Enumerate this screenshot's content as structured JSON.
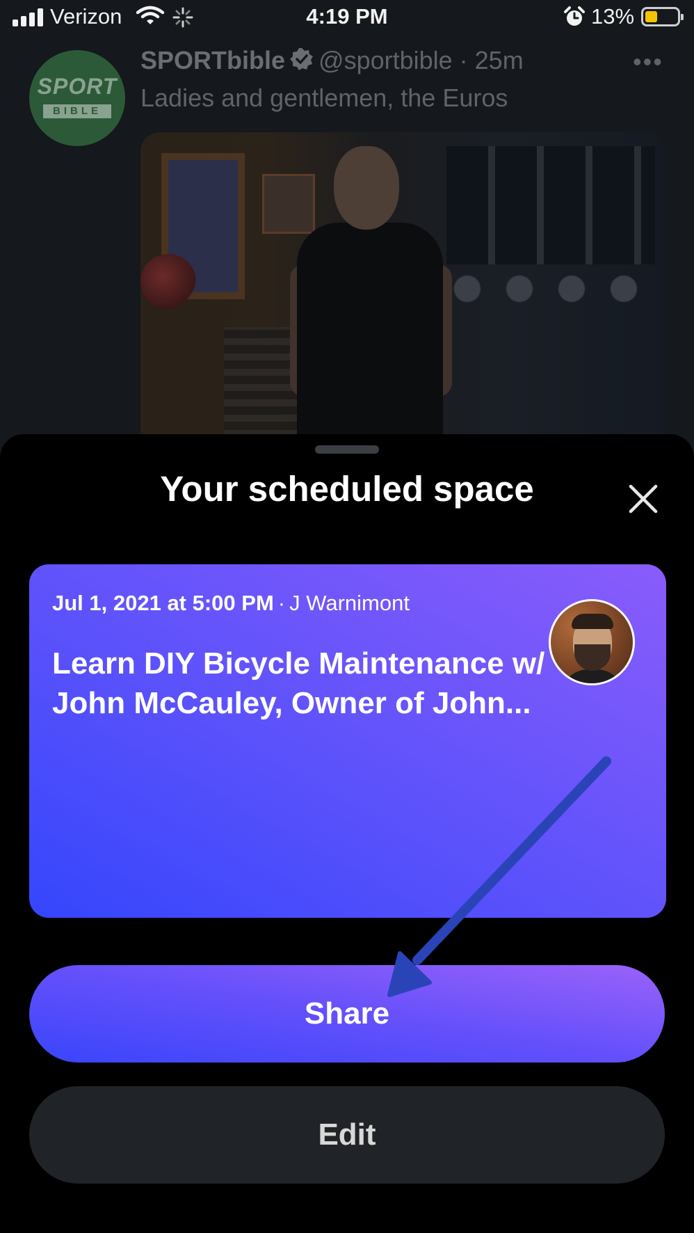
{
  "status_bar": {
    "carrier": "Verizon",
    "time": "4:19 PM",
    "battery_percent": "13%",
    "battery_level": 0.13,
    "icons": [
      "signal-icon",
      "wifi-icon",
      "activity-spinner-icon",
      "alarm-icon",
      "battery-icon"
    ]
  },
  "tweet": {
    "display_name": "SPORTbible",
    "handle_time": "@sportbible · 25m",
    "text": "Ladies and gentlemen, the Euros",
    "avatar_logo_top": "SPORT",
    "avatar_logo_bottom": "BIBLE",
    "more_label": "•••"
  },
  "sheet": {
    "title": "Your scheduled space",
    "card": {
      "date": "Jul 1, 2021 at 5:00 PM",
      "separator": "·",
      "host": "J Warnimont",
      "title": "Learn DIY Bicycle Maintenance w/ John McCauley, Owner of John..."
    },
    "share_label": "Share",
    "edit_label": "Edit"
  },
  "colors": {
    "card_gradient_start": "#3546fc",
    "card_gradient_end": "#8a5cfb",
    "annotation_arrow": "#2a44b8",
    "verified_badge": "#6a6e72"
  }
}
